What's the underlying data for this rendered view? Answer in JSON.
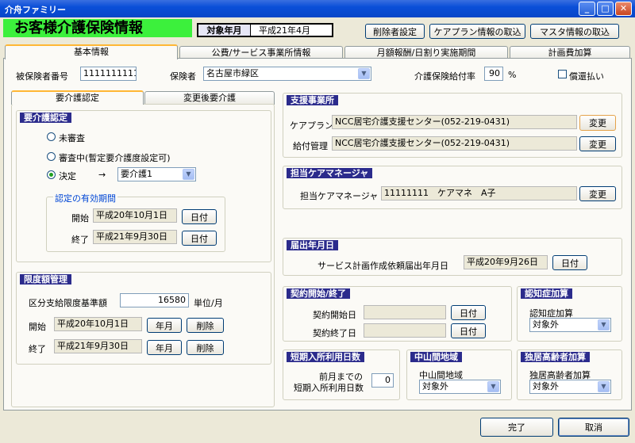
{
  "window": {
    "title": "介舟ファミリー",
    "min": "_",
    "max": "□",
    "close": "✕"
  },
  "header": {
    "title": "お客様介護保険情報",
    "target_label": "対象年月",
    "target_value": "平成21年4月",
    "btn_delete_setting": "削除者設定",
    "btn_careplan_import": "ケアプラン情報の取込",
    "btn_master_import": "マスタ情報の取込"
  },
  "tabs": [
    "基本情報",
    "公費/サービス事業所情報",
    "月額報酬/日割り実施期間",
    "計画費加算"
  ],
  "basic": {
    "insured_no_label": "被保険者番号",
    "insured_no": "1111111111",
    "insurer_label": "保険者",
    "insurer": "名古屋市緑区",
    "rate_label": "介護保険給付率",
    "rate": "90",
    "rate_unit": "%",
    "repay_label": "償還払い"
  },
  "subtabs": [
    "要介護認定",
    "変更後要介護"
  ],
  "care_cert": {
    "title": "要介護認定",
    "opt_unreviewed": "未審査",
    "opt_reviewing": "審査中(暫定要介護度設定可)",
    "opt_decided": "決定",
    "arrow": "→",
    "level": "要介護1",
    "validity_legend": "認定の有効期間",
    "start_label": "開始",
    "start_value": "平成20年10月1日",
    "end_label": "終了",
    "end_value": "平成21年9月30日",
    "date_btn": "日付"
  },
  "limit": {
    "title": "限度額管理",
    "base_label": "区分支給限度基準額",
    "base_value": "16580",
    "base_unit": "単位/月",
    "start_label": "開始",
    "start_value": "平成20年10月1日",
    "end_label": "終了",
    "end_value": "平成21年9月30日",
    "month_btn": "年月",
    "delete_btn": "削除"
  },
  "support": {
    "title": "支援事業所",
    "careplan_label": "ケアプラン",
    "careplan_value": "NCC居宅介護支援センター(052-219-0431)",
    "payment_label": "給付管理",
    "payment_value": "NCC居宅介護支援センター(052-219-0431)",
    "change_btn": "変更"
  },
  "manager": {
    "title": "担当ケアマネージャ",
    "label": "担当ケアマネージャ",
    "value": "11111111　ケアマネ　A子",
    "change_btn": "変更"
  },
  "notice": {
    "title": "届出年月日",
    "label": "サービス計画作成依頼届出年月日",
    "value": "平成20年9月26日",
    "date_btn": "日付"
  },
  "contract": {
    "title": "契約開始/終了",
    "start_label": "契約開始日",
    "end_label": "契約終了日",
    "date_btn": "日付"
  },
  "dementia": {
    "title": "認知症加算",
    "label": "認知症加算",
    "value": "対象外"
  },
  "short_stay": {
    "title": "短期入所利用日数",
    "label1": "前月までの",
    "label2": "短期入所利用日数",
    "value": "0"
  },
  "mountain": {
    "title": "中山間地域",
    "label": "中山間地域",
    "value": "対象外"
  },
  "elderly": {
    "title": "独居高齢者加算",
    "label": "独居高齢者加算",
    "value": "対象外"
  },
  "footer": {
    "done": "完了",
    "cancel": "取消"
  }
}
